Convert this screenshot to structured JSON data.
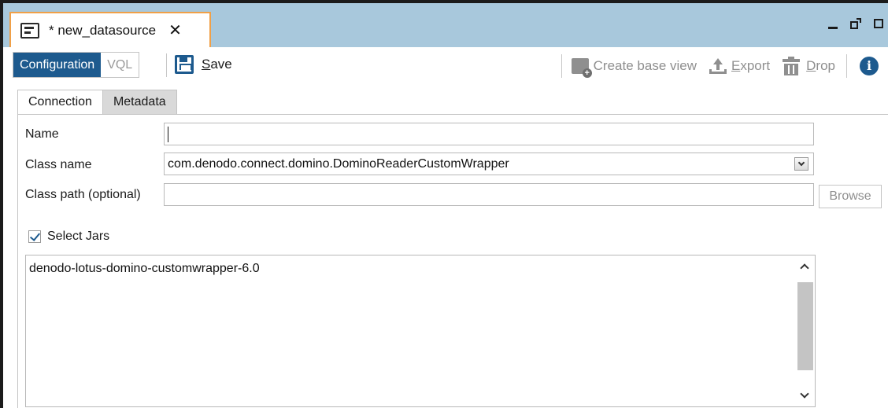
{
  "window": {
    "tab_title": "* new_datasource",
    "close_glyph": "✕"
  },
  "toolbar": {
    "mode_active": "Configuration",
    "mode_inactive": "VQL",
    "save_label": "Save",
    "create_base_view_label": "Create base view",
    "export_label": "Export",
    "drop_label": "Drop",
    "info_glyph": "i"
  },
  "tabs": [
    {
      "label": "Connection",
      "active": true
    },
    {
      "label": "Metadata",
      "active": false
    }
  ],
  "form": {
    "name_label": "Name",
    "name_value": "",
    "class_name_label": "Class name",
    "class_name_value": "com.denodo.connect.domino.DominoReaderCustomWrapper",
    "class_path_label": "Class path (optional)",
    "class_path_value": "",
    "browse_label": "Browse",
    "select_jars_label": "Select Jars",
    "select_jars_checked": true,
    "jars": [
      "denodo-lotus-domino-customwrapper-6.0"
    ]
  },
  "colors": {
    "accent": "#1d5a8e",
    "titlebar": "#a8c8dc",
    "tab_border": "#f0a048",
    "disabled_text": "#8f8f8f"
  },
  "icons": {
    "tab": "window-icon",
    "save": "floppy-disk-icon",
    "create_base_view": "table-add-icon",
    "export": "upload-icon",
    "drop": "trash-icon",
    "info": "info-circle-icon"
  }
}
